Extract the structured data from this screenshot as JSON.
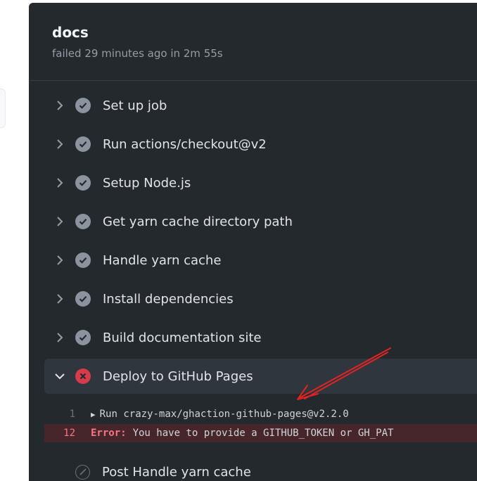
{
  "job": {
    "title": "docs",
    "subtitle": "failed 29 minutes ago in 2m 55s"
  },
  "steps": [
    {
      "label": "Set up job",
      "status": "success"
    },
    {
      "label": "Run actions/checkout@v2",
      "status": "success"
    },
    {
      "label": "Setup Node.js",
      "status": "success"
    },
    {
      "label": "Get yarn cache directory path",
      "status": "success"
    },
    {
      "label": "Handle yarn cache",
      "status": "success"
    },
    {
      "label": "Install dependencies",
      "status": "success"
    },
    {
      "label": "Build documentation site",
      "status": "success"
    },
    {
      "label": "Deploy to GitHub Pages",
      "status": "failure",
      "expanded": true
    },
    {
      "label": "Post Handle yarn cache",
      "status": "skipped"
    }
  ],
  "log": [
    {
      "line": "1",
      "text": "Run crazy-max/ghaction-github-pages@v2.2.0"
    },
    {
      "line": "12",
      "keyword": "Error:",
      "text": "You have to provide a GITHUB_TOKEN or GH_PAT"
    }
  ],
  "colors": {
    "panel_bg": "#24292e",
    "success": "#8b949e",
    "failure": "#d73a49",
    "annotation_arrow": "#e02424"
  }
}
